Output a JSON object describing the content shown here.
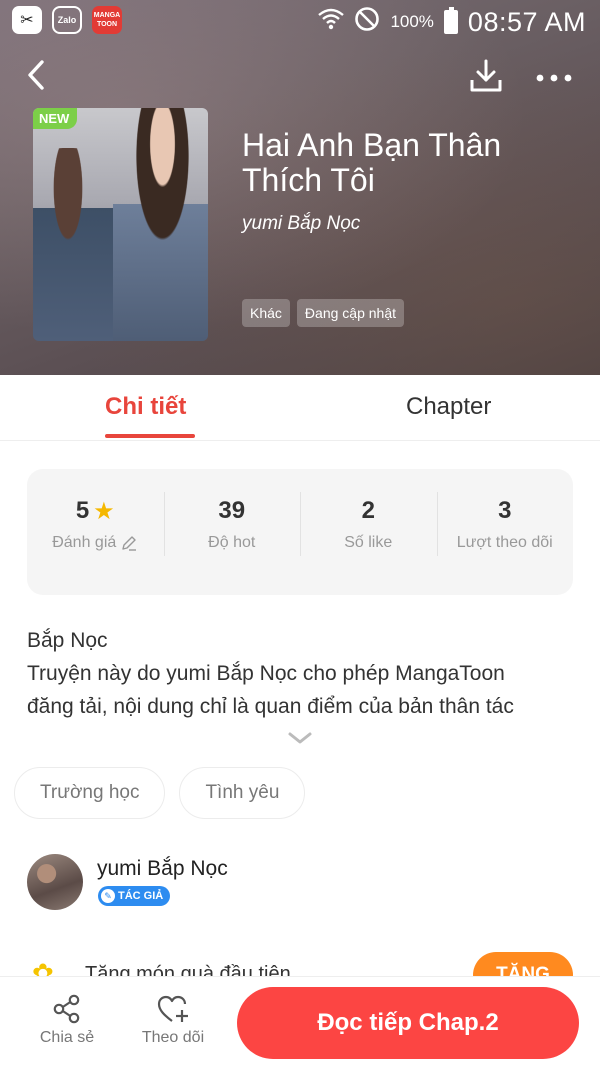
{
  "status_bar": {
    "apps": [
      "CapCut",
      "Zalo",
      "MANGA TOON"
    ],
    "battery": "100%",
    "time": "08:57 AM"
  },
  "header": {
    "badge": "NEW",
    "title": "Hai Anh Bạn Thân Thích Tôi",
    "author": "yumi Bắp Nọc",
    "tags": [
      "Khác",
      "Đang cập nhật"
    ]
  },
  "tabs": {
    "active": "Chi tiết",
    "other": "Chapter"
  },
  "stats": [
    {
      "value": "5",
      "label": "Đánh giá"
    },
    {
      "value": "39",
      "label": "Độ hot"
    },
    {
      "value": "2",
      "label": "Số like"
    },
    {
      "value": "3",
      "label": "Lượt theo dõi"
    }
  ],
  "description": {
    "line1": "Bắp Nọc",
    "line2": "Truyện này do yumi Bắp Nọc cho phép MangaToon",
    "line3": "đăng tải, nội dung chỉ là quan điểm của bản thân tác"
  },
  "genres": [
    "Trường học",
    "Tình yêu"
  ],
  "author_card": {
    "name": "yumi Bắp Nọc",
    "badge": "TÁC GIẢ"
  },
  "gift": {
    "text": "Tặng món quà đầu tiên",
    "button": "TẶNG"
  },
  "bottom_bar": {
    "share_label": "Chia sẻ",
    "follow_label": "Theo dõi",
    "read_label": "Đọc tiếp Chap.2"
  },
  "colors": {
    "accent": "#e8453c",
    "read_button": "#fc4543",
    "gift_button": "#ff8a1f",
    "author_badge": "#2d8cf0",
    "new_badge": "#7ccf48"
  }
}
